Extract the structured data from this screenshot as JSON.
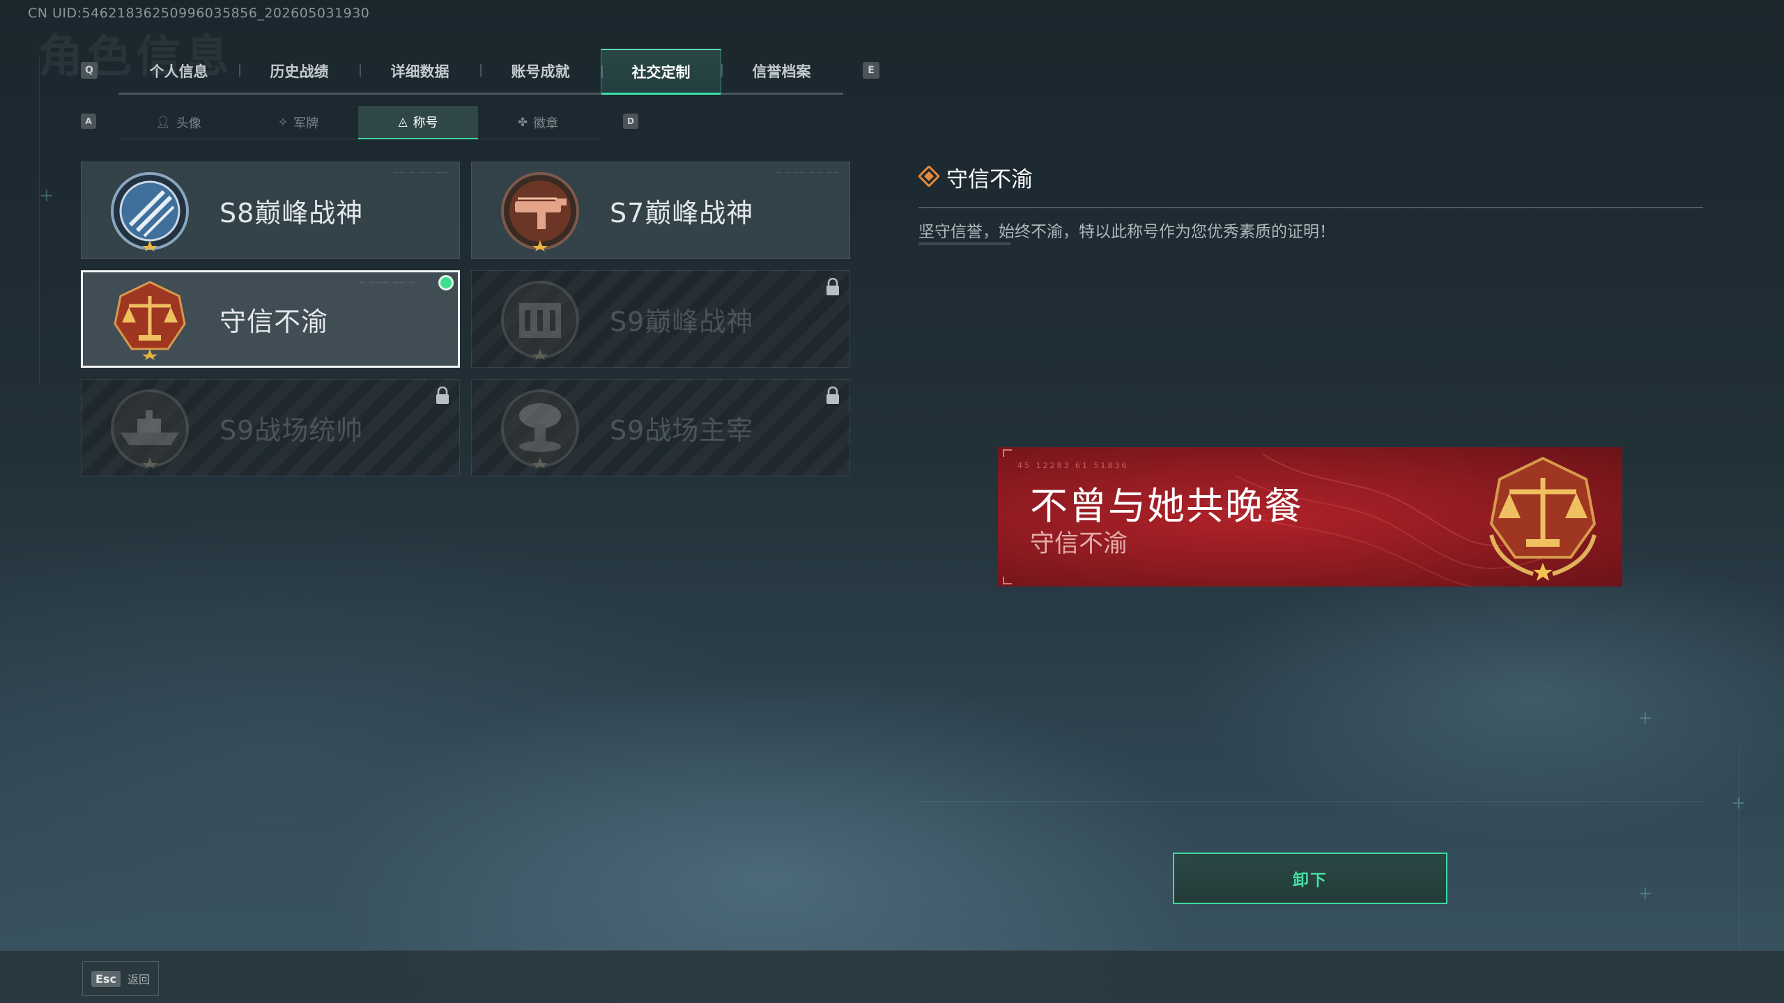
{
  "uid": "CN UID:5462183625099603585​6_202605031930",
  "ghost_title": "角色信息",
  "keys": {
    "prev_tab": "Q",
    "next_tab": "E",
    "prev_sub": "A",
    "next_sub": "D"
  },
  "tabs": [
    {
      "label": "个人信息"
    },
    {
      "label": "历史战绩"
    },
    {
      "label": "详细数据"
    },
    {
      "label": "账号成就"
    },
    {
      "label": "社交定制",
      "active": true
    },
    {
      "label": "信誉档案"
    }
  ],
  "subtabs": [
    {
      "label": "头像",
      "icon": "person-icon"
    },
    {
      "label": "军牌",
      "icon": "dogtag-icon"
    },
    {
      "label": "称号",
      "icon": "title-icon",
      "active": true
    },
    {
      "label": "徽章",
      "icon": "badge-icon"
    }
  ],
  "titles": [
    {
      "label": "S8巅峰战神",
      "emblem": "s8-stripes-emblem",
      "locked": false,
      "tiny": "—— — —— ——"
    },
    {
      "label": "S7巅峰战神",
      "emblem": "s7-gun-emblem",
      "locked": false,
      "tiny": "— ——— —— ——"
    },
    {
      "label": "守信不渝",
      "emblem": "scales-emblem",
      "locked": false,
      "selected": true,
      "equipped": true,
      "tiny": "— ——— —— —"
    },
    {
      "label": "S9巅峰战神",
      "emblem": "s9-building-emblem",
      "locked": true
    },
    {
      "label": "S9战场统帅",
      "emblem": "s9-ship-emblem",
      "locked": true
    },
    {
      "label": "S9战场主宰",
      "emblem": "s9-mushroom-cloud-emblem",
      "locked": true
    }
  ],
  "detail": {
    "title": "守信不渝",
    "description": "坚守信誉，始终不渝，特以此称号作为您优秀素质的证明！"
  },
  "banner": {
    "player_name": "不曾与她共晚餐",
    "title": "守信不渝",
    "tiny": "45 12283  61 51836"
  },
  "unequip_label": "卸下",
  "footer": {
    "esc_key": "Esc",
    "back_label": "返回"
  },
  "colors": {
    "accent": "#3fd99e",
    "banner_red": "#9a1c22",
    "equipped_dot": "#3ddf8e"
  }
}
